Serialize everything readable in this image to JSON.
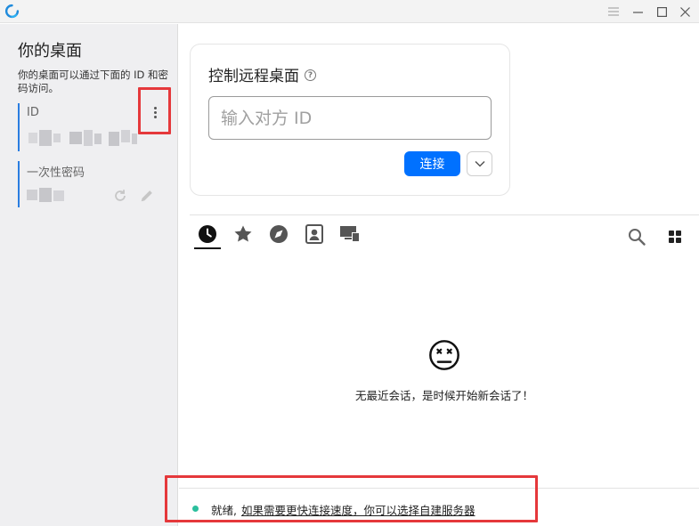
{
  "window": {
    "icons": {
      "logo": "rustdesk-logo-icon",
      "menu": "hamburger-menu-icon",
      "minimize": "minimize-icon",
      "maximize": "maximize-icon",
      "close": "close-icon"
    }
  },
  "left_panel": {
    "title": "你的桌面",
    "description": "你的桌面可以通过下面的 ID 和密码访问。",
    "id_label": "ID",
    "id_value_masked": true,
    "password_label": "一次性密码",
    "password_value_masked": true,
    "icons": {
      "more": "more-vertical-icon",
      "refresh": "refresh-icon",
      "edit": "pencil-icon"
    }
  },
  "connect_card": {
    "title": "控制远程桌面",
    "input_placeholder": "输入对方 ID",
    "input_value": "",
    "connect_label": "连接",
    "accent_color": "#0071ff"
  },
  "tabs": [
    {
      "name": "recent-sessions",
      "icon": "clock-icon",
      "active": true
    },
    {
      "name": "favorites",
      "icon": "star-icon",
      "active": false
    },
    {
      "name": "discovered",
      "icon": "compass-icon",
      "active": false
    },
    {
      "name": "address-book",
      "icon": "contacts-icon",
      "active": false
    },
    {
      "name": "group",
      "icon": "devices-icon",
      "active": false
    }
  ],
  "empty_state": {
    "icon": "sad-face-icon",
    "message": "无最近会话，是时候开始新会话了！"
  },
  "status_bar": {
    "status_text": "就绪,",
    "link_text": "如果需要更快连接速度，你可以选择自建服务器",
    "status_color": "#2bbf9d"
  },
  "annotation_color": "#e5383b"
}
